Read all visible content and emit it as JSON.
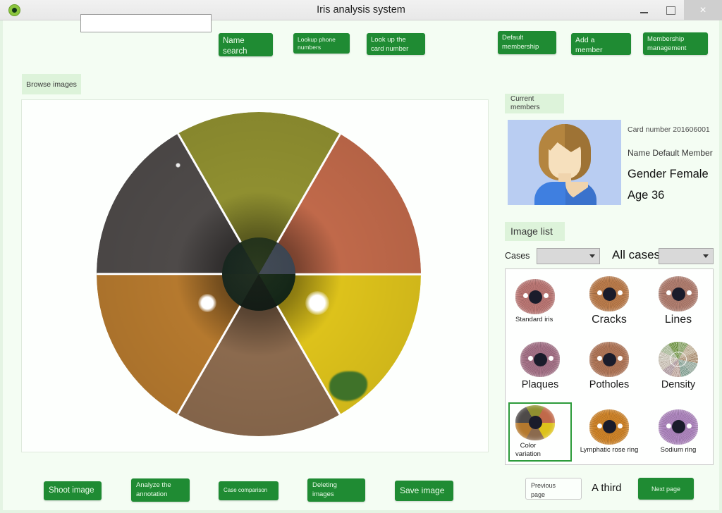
{
  "window": {
    "title": "Iris analysis system",
    "app_icon": "iris-eye-icon",
    "minimize_label": "minimize-icon",
    "maximize_label": "maximize-icon",
    "close_label": "×",
    "bg_color": "#f4fdf3",
    "accent_color": "#1f8b33",
    "tab_color": "#ddf3da"
  },
  "toolbar": {
    "search_value": "",
    "search_placeholder": "",
    "buttons": [
      {
        "name": "name-search",
        "label": "Name\nsearch"
      },
      {
        "name": "phone-lookup",
        "label": "Lookup phone\nnumbers"
      },
      {
        "name": "card-lookup",
        "label": "Look up the\ncard number"
      },
      {
        "name": "default-membership",
        "label": "Default\nmembership"
      },
      {
        "name": "add-member",
        "label": "Add a\nmember"
      },
      {
        "name": "membership-management",
        "label": "Membership\nmanagement"
      }
    ]
  },
  "viewer": {
    "tab_label": "Browse images",
    "iris_segments": [
      {
        "position": "top",
        "color": "#8f8f30",
        "note": "olive yellow"
      },
      {
        "position": "upper-right",
        "color": "#c0694a",
        "note": "orange red"
      },
      {
        "position": "lower-right",
        "color": "#ddc21b",
        "note": "yellow"
      },
      {
        "position": "bottom",
        "color": "#8b6a4e",
        "note": "brown"
      },
      {
        "position": "lower-left",
        "color": "#b5792e",
        "note": "tan orange"
      },
      {
        "position": "upper-left",
        "color": "#4e4a49",
        "note": "dark gray"
      }
    ]
  },
  "bottom_buttons": [
    {
      "name": "shoot-image",
      "label": "Shoot image"
    },
    {
      "name": "analyze-annotation",
      "label": "Analyze the\nannotation"
    },
    {
      "name": "case-comparison",
      "label": "Case comparison"
    },
    {
      "name": "deleting-images",
      "label": "Deleting\nimages"
    },
    {
      "name": "save-image",
      "label": "Save image"
    }
  ],
  "member_panel": {
    "tab_label": "Current\nmembers",
    "avatar": "default-member-avatar",
    "card_number": "Card number 201606001",
    "name": "Name Default Member",
    "gender": "Gender Female",
    "age": "Age 36"
  },
  "image_list": {
    "tab_label": "Image list",
    "cases_label": "Cases",
    "cases_selected": "",
    "all_cases_label": "All cases",
    "all_cases_selected": "",
    "thumbnails": [
      {
        "label": "Standard iris",
        "size": "sm",
        "selected": false,
        "kind": "eye",
        "iris_color": "#c07a77"
      },
      {
        "label": "Cracks",
        "size": "big",
        "selected": false,
        "kind": "eye",
        "iris_color": "#c07f4d"
      },
      {
        "label": "Lines",
        "size": "big",
        "selected": false,
        "kind": "eye",
        "iris_color": "#b58172"
      },
      {
        "label": "Plaques",
        "size": "med",
        "selected": false,
        "kind": "eye",
        "iris_color": "#a9758b"
      },
      {
        "label": "Potholes",
        "size": "med",
        "selected": false,
        "kind": "eye",
        "iris_color": "#b5795a"
      },
      {
        "label": "Density",
        "size": "med",
        "selected": false,
        "kind": "density",
        "iris_color": "#8fae6a"
      },
      {
        "label": "Color\nvariation",
        "size": "sm",
        "selected": true,
        "kind": "multi",
        "iris_color": "#8f8f30"
      },
      {
        "label": "Lymphatic rose ring",
        "size": "sm",
        "selected": false,
        "kind": "eye",
        "iris_color": "#d4872a"
      },
      {
        "label": "Sodium ring",
        "size": "sm",
        "selected": false,
        "kind": "eye",
        "iris_color": "#b38ac4"
      }
    ]
  },
  "pagination": {
    "previous_label": "Previous\npage",
    "page_label": "A third",
    "next_label": "Next page"
  }
}
